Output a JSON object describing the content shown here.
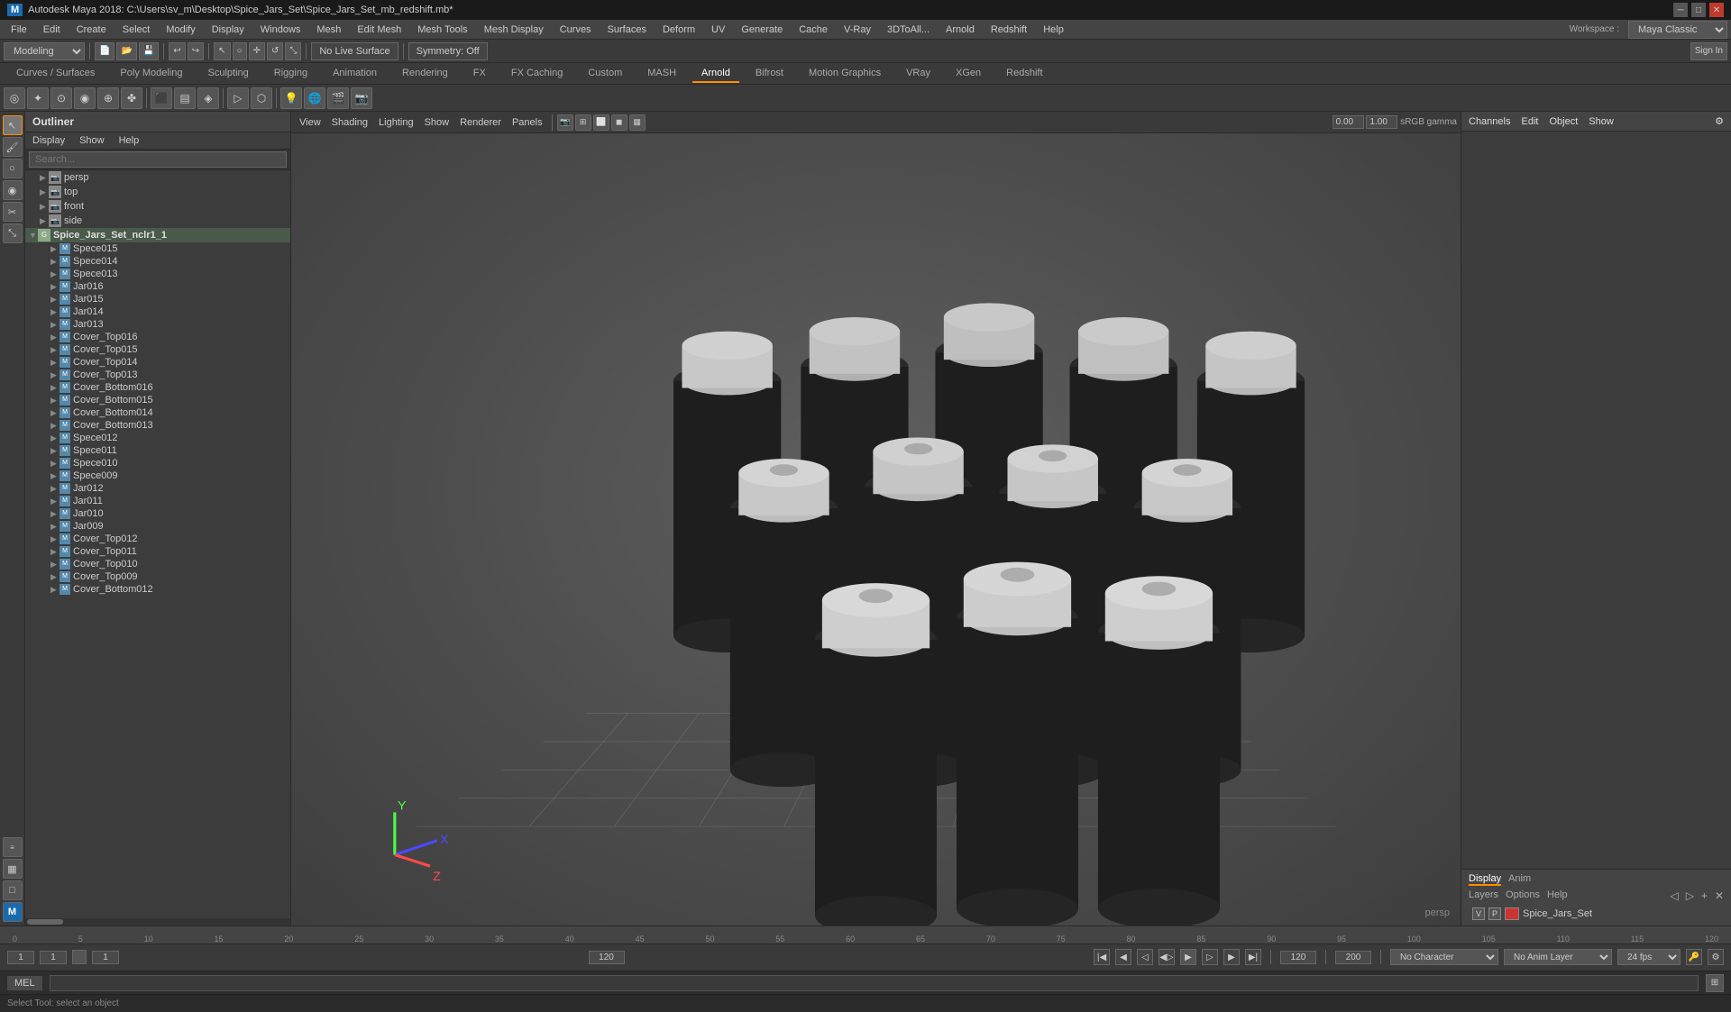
{
  "titlebar": {
    "title": "Autodesk Maya 2018: C:\\Users\\sv_m\\Desktop\\Spice_Jars_Set\\Spice_Jars_Set_mb_redshift.mb*",
    "icon": "maya-icon",
    "controls": [
      "minimize",
      "maximize",
      "close"
    ]
  },
  "menubar": {
    "items": [
      "File",
      "Edit",
      "Create",
      "Select",
      "Modify",
      "Display",
      "Windows",
      "Mesh",
      "Edit Mesh",
      "Mesh Tools",
      "Mesh Display",
      "Curves",
      "Surfaces",
      "Deform",
      "UV",
      "Generate",
      "Cache",
      "V-Ray",
      "3DtoAll...",
      "Arnold",
      "Redshift",
      "Help"
    ]
  },
  "modebar": {
    "mode": "Modeling",
    "live_surface": "No Live Surface",
    "symmetry": "Symmetry: Off",
    "workspace_label": "Workspace :",
    "workspace_value": "Maya Classic",
    "sign_in": "Sign In"
  },
  "tabbar": {
    "tabs": [
      {
        "label": "Curves / Surfaces",
        "active": false
      },
      {
        "label": "Poly Modeling",
        "active": false
      },
      {
        "label": "Sculpting",
        "active": false
      },
      {
        "label": "Rigging",
        "active": false
      },
      {
        "label": "Animation",
        "active": false
      },
      {
        "label": "Rendering",
        "active": false
      },
      {
        "label": "FX",
        "active": false
      },
      {
        "label": "FX Caching",
        "active": false
      },
      {
        "label": "Custom",
        "active": false
      },
      {
        "label": "MASH",
        "active": false
      },
      {
        "label": "Arnold",
        "active": true
      },
      {
        "label": "Bifrost",
        "active": false
      },
      {
        "label": "Motion Graphics",
        "active": false
      },
      {
        "label": "VRay",
        "active": false
      },
      {
        "label": "XGen",
        "active": false
      },
      {
        "label": "Redshift",
        "active": false
      }
    ]
  },
  "outliner": {
    "title": "Outliner",
    "menu": [
      "Display",
      "Show",
      "Help"
    ],
    "search_placeholder": "Search...",
    "items": [
      {
        "label": "persp",
        "indent": 0,
        "type": "camera",
        "arrow": "▶"
      },
      {
        "label": "top",
        "indent": 0,
        "type": "camera",
        "arrow": "▶"
      },
      {
        "label": "front",
        "indent": 0,
        "type": "camera",
        "arrow": "▶"
      },
      {
        "label": "side",
        "indent": 0,
        "type": "camera",
        "arrow": "▶"
      },
      {
        "label": "Spice_Jars_Set_nclr1_1",
        "indent": 0,
        "type": "group",
        "arrow": "▼"
      },
      {
        "label": "Spece015",
        "indent": 2,
        "type": "mesh",
        "arrow": "▶"
      },
      {
        "label": "Spece014",
        "indent": 2,
        "type": "mesh",
        "arrow": "▶"
      },
      {
        "label": "Spece013",
        "indent": 2,
        "type": "mesh",
        "arrow": "▶"
      },
      {
        "label": "Jar016",
        "indent": 2,
        "type": "mesh",
        "arrow": "▶"
      },
      {
        "label": "Jar015",
        "indent": 2,
        "type": "mesh",
        "arrow": "▶"
      },
      {
        "label": "Jar014",
        "indent": 2,
        "type": "mesh",
        "arrow": "▶"
      },
      {
        "label": "Jar013",
        "indent": 2,
        "type": "mesh",
        "arrow": "▶"
      },
      {
        "label": "Cover_Top016",
        "indent": 2,
        "type": "mesh",
        "arrow": "▶"
      },
      {
        "label": "Cover_Top015",
        "indent": 2,
        "type": "mesh",
        "arrow": "▶"
      },
      {
        "label": "Cover_Top014",
        "indent": 2,
        "type": "mesh",
        "arrow": "▶"
      },
      {
        "label": "Cover_Top013",
        "indent": 2,
        "type": "mesh",
        "arrow": "▶"
      },
      {
        "label": "Cover_Bottom016",
        "indent": 2,
        "type": "mesh",
        "arrow": "▶"
      },
      {
        "label": "Cover_Bottom015",
        "indent": 2,
        "type": "mesh",
        "arrow": "▶"
      },
      {
        "label": "Cover_Bottom014",
        "indent": 2,
        "type": "mesh",
        "arrow": "▶"
      },
      {
        "label": "Cover_Bottom013",
        "indent": 2,
        "type": "mesh",
        "arrow": "▶"
      },
      {
        "label": "Spece012",
        "indent": 2,
        "type": "mesh",
        "arrow": "▶"
      },
      {
        "label": "Spece011",
        "indent": 2,
        "type": "mesh",
        "arrow": "▶"
      },
      {
        "label": "Spece010",
        "indent": 2,
        "type": "mesh",
        "arrow": "▶"
      },
      {
        "label": "Spece009",
        "indent": 2,
        "type": "mesh",
        "arrow": "▶"
      },
      {
        "label": "Jar012",
        "indent": 2,
        "type": "mesh",
        "arrow": "▶"
      },
      {
        "label": "Jar011",
        "indent": 2,
        "type": "mesh",
        "arrow": "▶"
      },
      {
        "label": "Jar010",
        "indent": 2,
        "type": "mesh",
        "arrow": "▶"
      },
      {
        "label": "Jar009",
        "indent": 2,
        "type": "mesh",
        "arrow": "▶"
      },
      {
        "label": "Cover_Top012",
        "indent": 2,
        "type": "mesh",
        "arrow": "▶"
      },
      {
        "label": "Cover_Top011",
        "indent": 2,
        "type": "mesh",
        "arrow": "▶"
      },
      {
        "label": "Cover_Top010",
        "indent": 2,
        "type": "mesh",
        "arrow": "▶"
      },
      {
        "label": "Cover_Top009",
        "indent": 2,
        "type": "mesh",
        "arrow": "▶"
      },
      {
        "label": "Cover_Bottom012",
        "indent": 2,
        "type": "mesh",
        "arrow": "▶"
      }
    ]
  },
  "viewport": {
    "menus": [
      "View",
      "Shading",
      "Lighting",
      "Show",
      "Renderer",
      "Panels"
    ],
    "camera_label": "persp",
    "gamma_label": "sRGB gamma",
    "gamma_value": "0.00",
    "exposure_value": "1.00"
  },
  "channelbox": {
    "tabs": [
      "Channels",
      "Edit",
      "Object",
      "Show"
    ]
  },
  "display_panel": {
    "tabs": [
      "Display",
      "Anim"
    ],
    "active_tab": "Display",
    "layer_tabs": [
      "Layers",
      "Options",
      "Help"
    ],
    "layers": [
      {
        "v": "V",
        "p": "P",
        "color": "#cc3333",
        "name": "Spice_Jars_Set"
      }
    ]
  },
  "timeline": {
    "ticks": [
      "0",
      "5",
      "10",
      "15",
      "20",
      "25",
      "30",
      "35",
      "40",
      "45",
      "50",
      "55",
      "60",
      "65",
      "70",
      "75",
      "80",
      "85",
      "90",
      "95",
      "100",
      "105",
      "110",
      "115",
      "120"
    ],
    "start_frame": "1",
    "end_frame": "120",
    "current_frame": "1",
    "range_start": "1",
    "range_end": "200",
    "fps": "24 fps",
    "no_character": "No Character",
    "no_anim_layer": "No Anim Layer"
  },
  "bottombar": {
    "mode": "MEL",
    "status": "Select Tool: select an object"
  },
  "icons": {
    "maya_logo": "M",
    "arrow_icon": "↖",
    "move_icon": "✛",
    "rotate_icon": "↺",
    "scale_icon": "⤡"
  }
}
